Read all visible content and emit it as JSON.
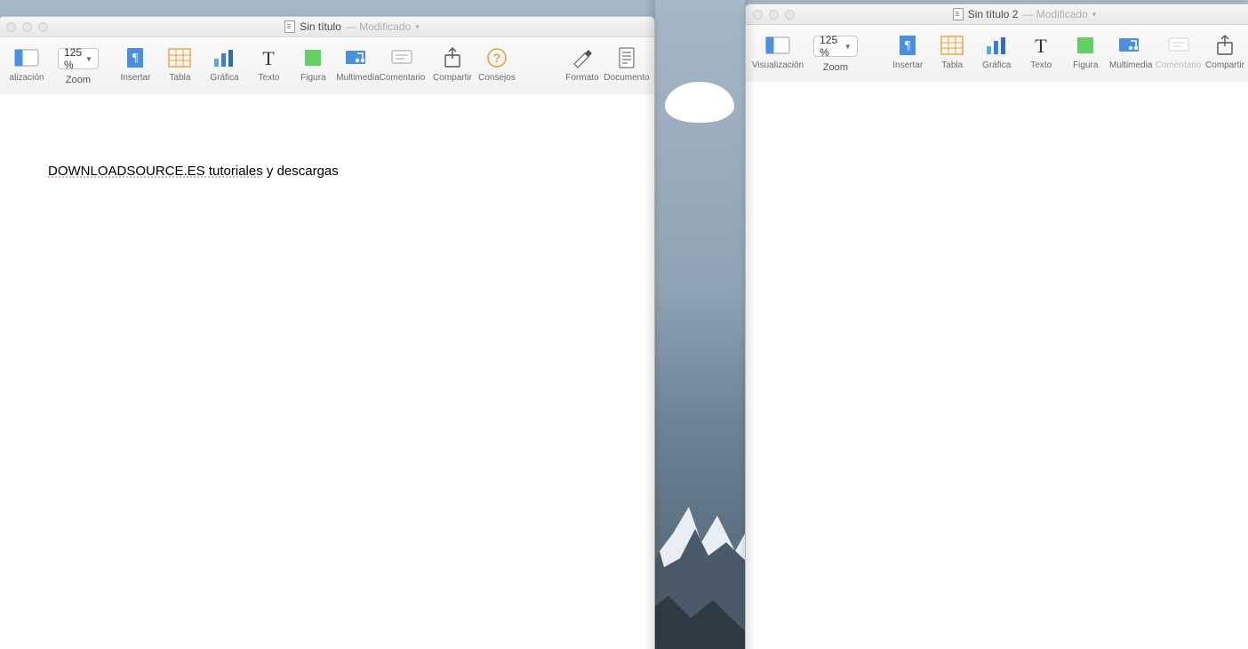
{
  "window1": {
    "title": "Sin título",
    "modified_suffix": "— Modificado",
    "zoom_value": "125 %",
    "toolbar": {
      "visualizacion": "alización",
      "zoom": "Zoom",
      "insertar": "Insertar",
      "tabla": "Tabla",
      "grafica": "Gráfica",
      "texto": "Texto",
      "figura": "Figura",
      "multimedia": "Multimedia",
      "comentario": "Comentario",
      "compartir": "Compartir",
      "consejos": "Consejos",
      "formato": "Formato",
      "documento": "Documento"
    },
    "body_text": {
      "underlined": "DOWNLOADSOURCE.ES tutoriales",
      "rest": " y descargas"
    }
  },
  "window2": {
    "title": "Sin título 2",
    "modified_suffix": "— Modificado",
    "zoom_value": "125 %",
    "toolbar": {
      "visualizacion": "Visualización",
      "zoom": "Zoom",
      "insertar": "Insertar",
      "tabla": "Tabla",
      "grafica": "Gráfica",
      "texto": "Texto",
      "figura": "Figura",
      "multimedia": "Multimedia",
      "comentario": "Comentario",
      "compartir": "Compartir"
    }
  }
}
